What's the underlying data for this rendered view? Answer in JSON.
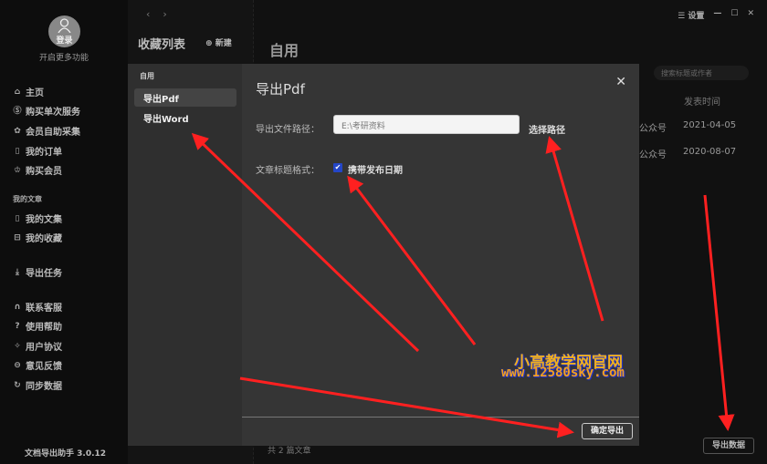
{
  "sidebar": {
    "avatar_label": "登录",
    "hint": "开启更多功能",
    "items": [
      {
        "label": "主页",
        "icon": "home-icon"
      },
      {
        "label": "购买单次服务",
        "icon": "coin-icon"
      },
      {
        "label": "会员自助采集",
        "icon": "gift-icon"
      },
      {
        "label": "我的订单",
        "icon": "order-icon"
      },
      {
        "label": "购买会员",
        "icon": "vip-icon"
      }
    ],
    "section_articles": "我的文章",
    "article_items": [
      {
        "label": "我的文集"
      },
      {
        "label": "我的收藏"
      }
    ],
    "export_tasks": "导出任务",
    "help_items": [
      {
        "label": "联系客服"
      },
      {
        "label": "使用帮助"
      },
      {
        "label": "用户协议"
      },
      {
        "label": "意见反馈"
      },
      {
        "label": "同步数据"
      }
    ],
    "version": "文档导出助手 3.0.12"
  },
  "mid": {
    "title": "收藏列表",
    "new_label": "新建"
  },
  "nav": {
    "back": "‹",
    "forward": "›"
  },
  "topbar": {
    "settings": "设置",
    "minimize": "—",
    "maximize": "☐",
    "close": "✕"
  },
  "main": {
    "title": "自用",
    "search_placeholder": "搜索标题或作者",
    "col_time": "发表时间",
    "rows": [
      {
        "source": "公众号",
        "date": "2021-04-05"
      },
      {
        "source": "公众号",
        "date": "2020-08-07"
      }
    ],
    "count": "共 2 篇文章",
    "export_data": "导出数据"
  },
  "modal": {
    "section": "自用",
    "menu": [
      {
        "label": "导出Pdf"
      },
      {
        "label": "导出Word"
      }
    ],
    "title": "导出Pdf",
    "close": "✕",
    "path_label": "导出文件路径：",
    "path_value": "E:\\考研资料",
    "pick_path": "选择路径",
    "format_label": "文章标题格式：",
    "include_date": "携带发布日期",
    "include_date_checked": true,
    "confirm": "确定导出"
  },
  "watermark": {
    "line1": "小高教学网官网",
    "line2": "www.12580sky.com"
  },
  "colors": {
    "accent": "#2446c8",
    "arrow": "#ff2020"
  }
}
